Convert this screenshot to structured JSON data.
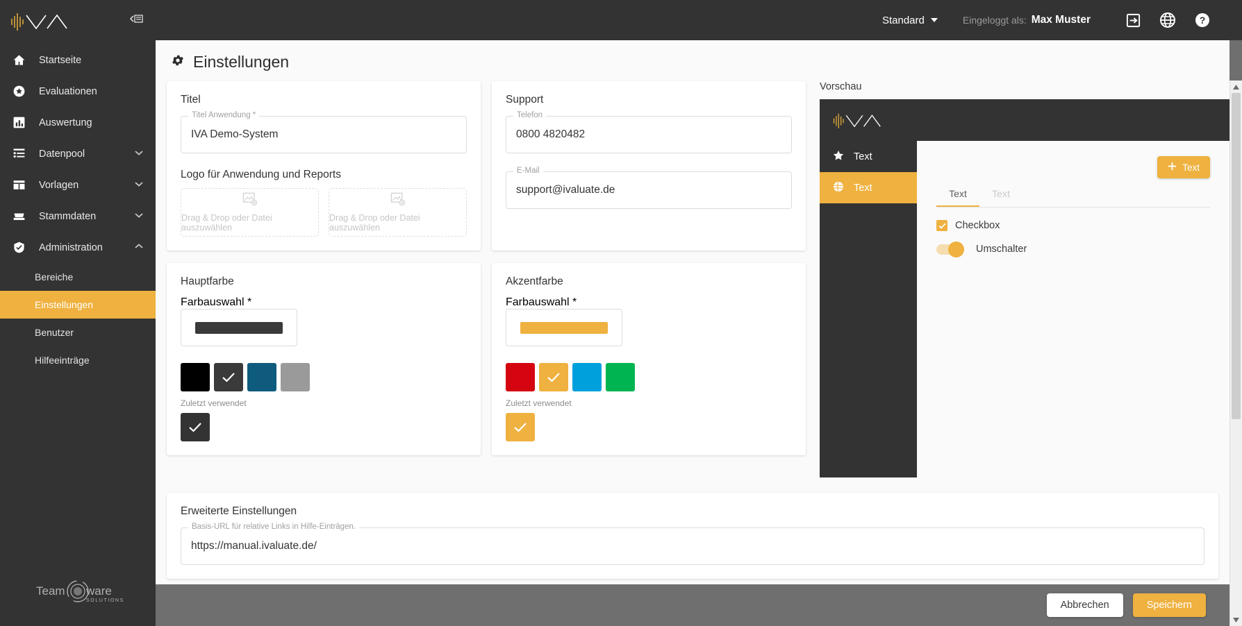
{
  "app": {
    "logo_name": "iva-logo",
    "collapse_icon": "collapse-sidebar-icon"
  },
  "topbar": {
    "scope_label": "Standard",
    "logged_in_label": "Eingeloggt als:",
    "user_name": "Max Muster",
    "logout_icon": "logout-icon",
    "language_icon": "globe-icon",
    "help_icon": "help-icon"
  },
  "sidebar": {
    "items": [
      {
        "label": "Startseite",
        "icon": "home-icon",
        "expandable": false
      },
      {
        "label": "Evaluationen",
        "icon": "star-circle-icon",
        "expandable": false
      },
      {
        "label": "Auswertung",
        "icon": "bar-chart-icon",
        "expandable": false
      },
      {
        "label": "Datenpool",
        "icon": "list-icon",
        "expandable": true,
        "chevron": "chevron-down-icon"
      },
      {
        "label": "Vorlagen",
        "icon": "template-icon",
        "expandable": true,
        "chevron": "chevron-down-icon"
      },
      {
        "label": "Stammdaten",
        "icon": "tray-icon",
        "expandable": true,
        "chevron": "chevron-down-icon"
      },
      {
        "label": "Administration",
        "icon": "shield-check-icon",
        "expandable": true,
        "chevron": "chevron-up-icon"
      }
    ],
    "subitems": [
      {
        "label": "Bereiche",
        "active": false
      },
      {
        "label": "Einstellungen",
        "active": true
      },
      {
        "label": "Benutzer",
        "active": false
      },
      {
        "label": "Hilfeeinträge",
        "active": false
      }
    ],
    "footer_logo": "teamware-solutions-logo"
  },
  "page": {
    "title": "Einstellungen",
    "title_icon": "gear-icon"
  },
  "titel_card": {
    "heading": "Titel",
    "field_label": "Titel Anwendung *",
    "field_value": "IVA Demo-System",
    "logo_heading": "Logo für Anwendung und Reports",
    "dropzones": [
      {
        "label": "Drag & Drop oder Datei auszuwählen",
        "icon": "image-add-icon"
      },
      {
        "label": "Drag & Drop oder Datei auszuwählen",
        "icon": "image-add-icon"
      }
    ]
  },
  "support_card": {
    "heading": "Support",
    "phone_label": "Telefon",
    "phone_value": "0800 4820482",
    "email_label": "E-Mail",
    "email_value": "support@ivaluate.de"
  },
  "hauptfarbe": {
    "heading": "Hauptfarbe",
    "field_label": "Farbauswahl *",
    "current_color": "#3a3a3a",
    "swatches": [
      {
        "color": "#000000",
        "selected": false
      },
      {
        "color": "#3a3a3a",
        "selected": true
      },
      {
        "color": "#0e5b7d",
        "selected": false
      },
      {
        "color": "#9a9a9a",
        "selected": false
      }
    ],
    "recent_label": "Zuletzt verwendet",
    "recent": [
      {
        "color": "#333333",
        "selected": true
      }
    ]
  },
  "akzentfarbe": {
    "heading": "Akzentfarbe",
    "field_label": "Farbauswahl *",
    "current_color": "#efb13f",
    "swatches": [
      {
        "color": "#d40511",
        "selected": false
      },
      {
        "color": "#efb13f",
        "selected": true
      },
      {
        "color": "#00a0dd",
        "selected": false
      },
      {
        "color": "#00b452",
        "selected": false
      }
    ],
    "recent_label": "Zuletzt verwendet",
    "recent": [
      {
        "color": "#efb13f",
        "selected": true
      }
    ]
  },
  "vorschau": {
    "label": "Vorschau",
    "nav": [
      {
        "label": "Text",
        "icon": "star-icon",
        "active": false
      },
      {
        "label": "Text",
        "icon": "globe-icon",
        "active": true
      }
    ],
    "add_button": "Text",
    "add_button_icon": "plus-icon",
    "tabs": [
      {
        "label": "Text",
        "active": true
      },
      {
        "label": "Text",
        "active": false
      }
    ],
    "checkbox_label": "Checkbox",
    "checkbox_checked": true,
    "toggle_label": "Umschalter",
    "toggle_on": true
  },
  "erweiterte": {
    "heading": "Erweiterte Einstellungen",
    "field_label": "Basis-URL für relative Links in Hilfe-Einträgen.",
    "field_value": "https://manual.ivaluate.de/"
  },
  "footer": {
    "cancel_label": "Abbrechen",
    "save_label": "Speichern"
  },
  "colors": {
    "accent": "#efb13f",
    "dark": "#333333",
    "page_bg": "#6f6f6f"
  }
}
